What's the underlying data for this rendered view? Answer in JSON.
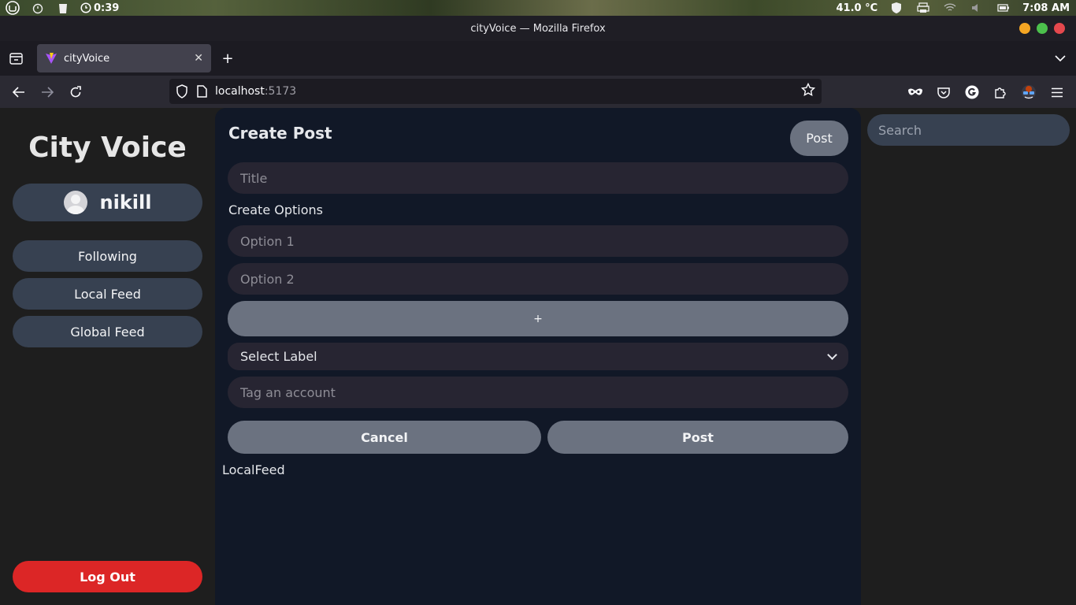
{
  "system": {
    "timer": "0:39",
    "temperature": "41.0 °C",
    "clock": "7:08 AM"
  },
  "window": {
    "title": "cityVoice — Mozilla Firefox"
  },
  "tabs": [
    {
      "label": "cityVoice"
    }
  ],
  "address_bar": {
    "host": "localhost",
    "port": ":5173"
  },
  "sidebar": {
    "brand": "City Voice",
    "username": "nikill",
    "nav_items": [
      {
        "label": "Following"
      },
      {
        "label": "Local Feed"
      },
      {
        "label": "Global Feed"
      }
    ],
    "logout_label": "Log Out"
  },
  "create_post": {
    "heading": "Create Post",
    "top_post_label": "Post",
    "title_placeholder": "Title",
    "options_label": "Create Options",
    "option1_placeholder": "Option 1",
    "option2_placeholder": "Option 2",
    "add_option_label": "+",
    "select_label": "Select Label",
    "tag_placeholder": "Tag an account",
    "cancel_label": "Cancel",
    "post_label": "Post"
  },
  "feed": {
    "label": "LocalFeed"
  },
  "search": {
    "placeholder": "Search"
  },
  "colors": {
    "sidebar_button": "#374151",
    "main_panel": "#111827",
    "gray_button": "#6b7280",
    "logout": "#dc2626",
    "input_bg": "#272532"
  }
}
